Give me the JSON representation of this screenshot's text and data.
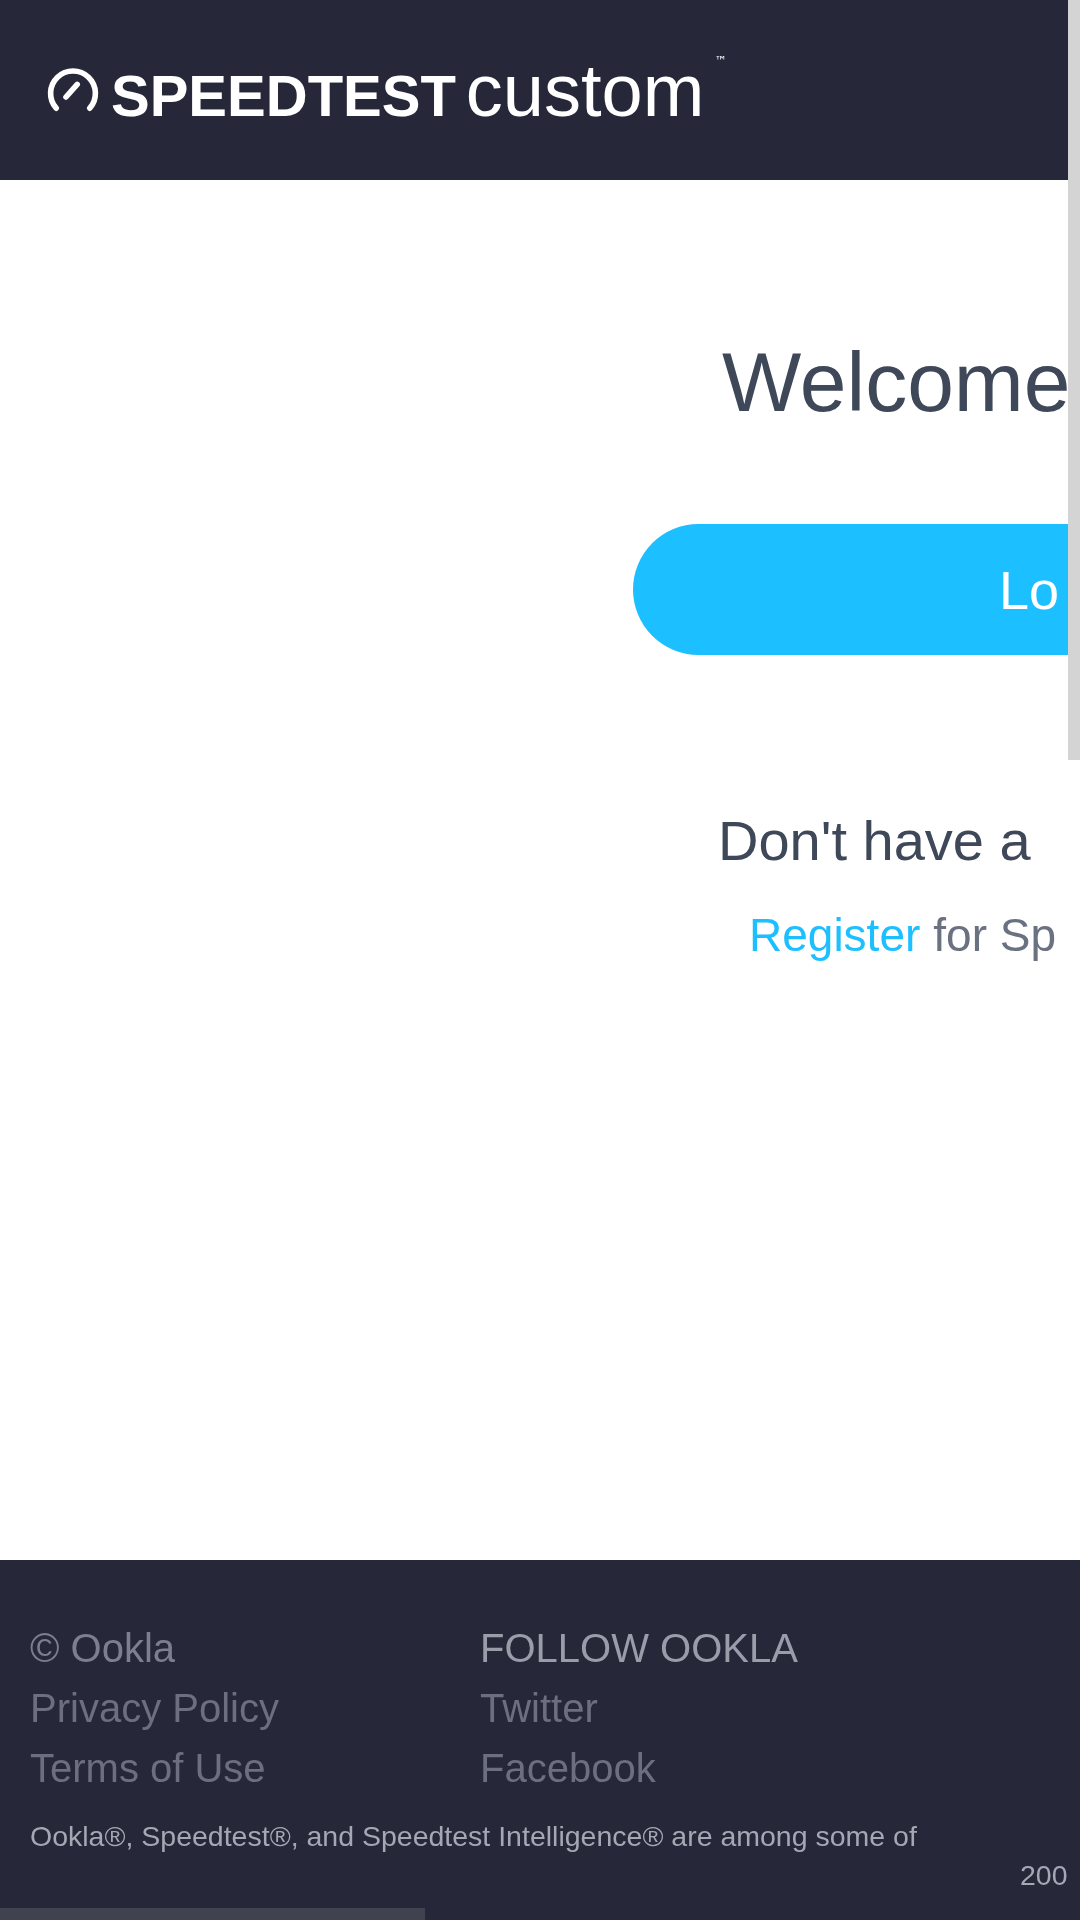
{
  "header": {
    "logo_bold": "SPEEDTEST",
    "logo_light": "custom",
    "trademark": "™"
  },
  "main": {
    "title": "Welcome",
    "login_button": "Lo",
    "signup_prompt": "Don't have a",
    "register_link": "Register",
    "register_text": "for Sp"
  },
  "footer": {
    "left_links": [
      "© Ookla",
      "Privacy Policy",
      "Terms of Use"
    ],
    "follow_heading": "FOLLOW OOKLA",
    "social_links": [
      "Twitter",
      "Facebook"
    ],
    "legal_line": "Ookla®, Speedtest®, and Speedtest Intelligence® are among some of",
    "legal_line_2": "200"
  }
}
